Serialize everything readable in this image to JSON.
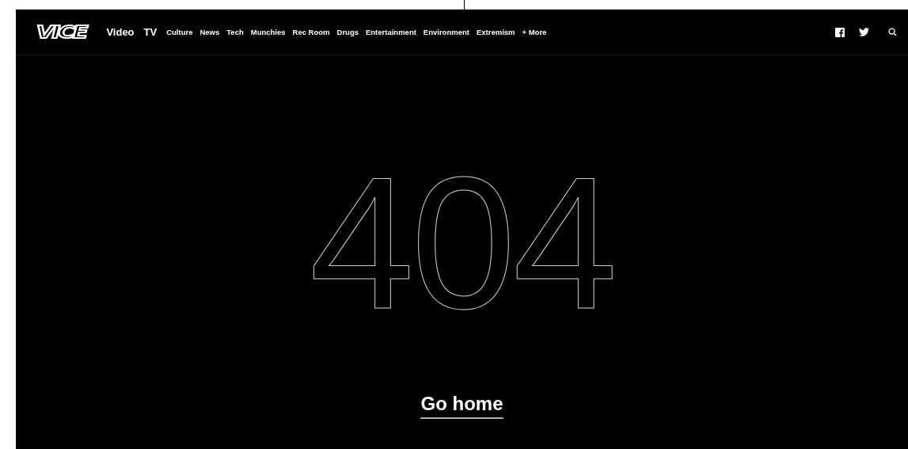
{
  "header": {
    "logo": "VICE",
    "nav": [
      {
        "label": "Video",
        "kind": "primary"
      },
      {
        "label": "TV",
        "kind": "primary"
      },
      {
        "label": "Culture",
        "kind": "secondary"
      },
      {
        "label": "News",
        "kind": "secondary"
      },
      {
        "label": "Tech",
        "kind": "secondary"
      },
      {
        "label": "Munchies",
        "kind": "secondary"
      },
      {
        "label": "Rec Room",
        "kind": "secondary"
      },
      {
        "label": "Drugs",
        "kind": "secondary"
      },
      {
        "label": "Entertainment",
        "kind": "secondary"
      },
      {
        "label": "Environment",
        "kind": "secondary"
      },
      {
        "label": "Extremism",
        "kind": "secondary"
      },
      {
        "label": "+ More",
        "kind": "secondary"
      }
    ]
  },
  "error": {
    "code": "404",
    "link": "Go home"
  }
}
